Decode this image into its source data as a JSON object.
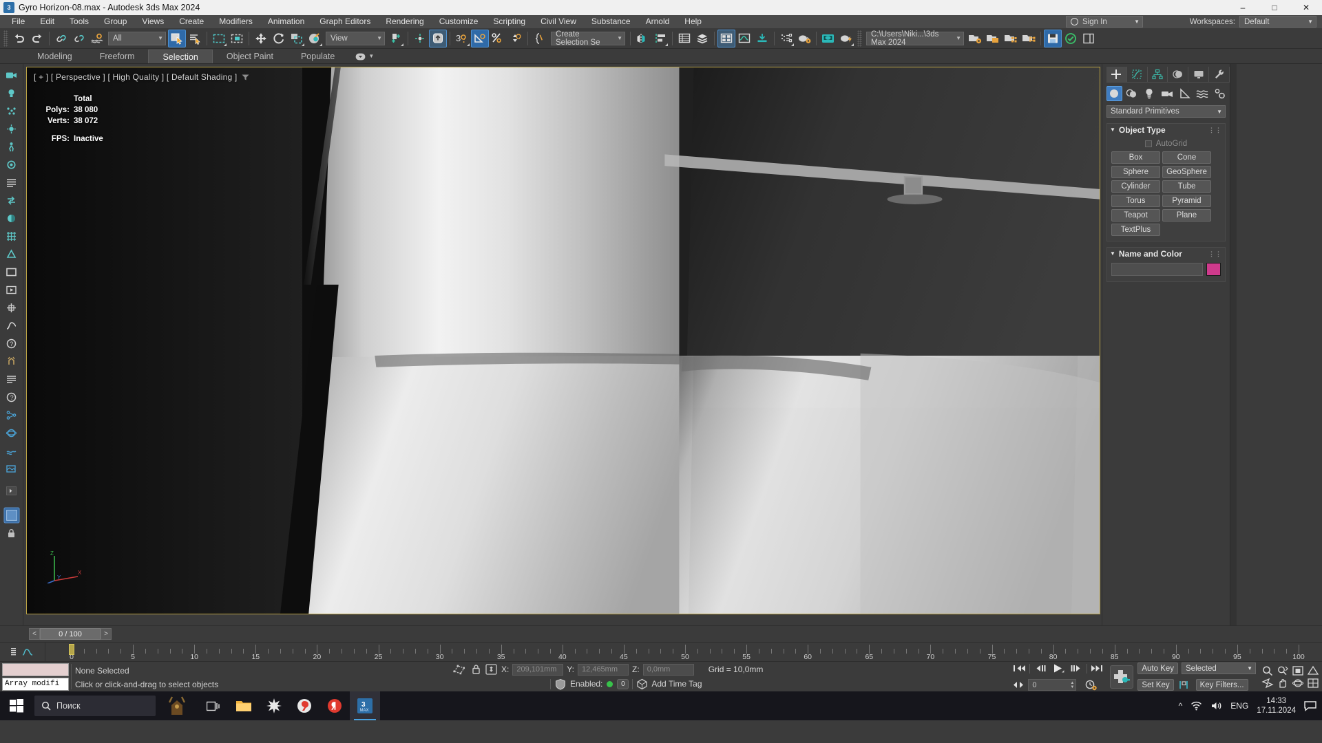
{
  "window": {
    "title": "Gyro Horizon-08.max - Autodesk 3ds Max 2024",
    "app_icon": "3ds-max-icon",
    "minimize": "–",
    "maximize": "□",
    "close": "✕"
  },
  "menu": {
    "items": [
      {
        "label": "File",
        "accel": "F"
      },
      {
        "label": "Edit",
        "accel": "E"
      },
      {
        "label": "Tools",
        "accel": "T"
      },
      {
        "label": "Group",
        "accel": "G"
      },
      {
        "label": "Views",
        "accel": "V"
      },
      {
        "label": "Create",
        "accel": "C"
      },
      {
        "label": "Modifiers",
        "accel": "M"
      },
      {
        "label": "Animation",
        "accel": "A"
      },
      {
        "label": "Graph Editors",
        "accel": "G"
      },
      {
        "label": "Rendering",
        "accel": "R"
      },
      {
        "label": "Customize",
        "accel": "u"
      },
      {
        "label": "Scripting",
        "accel": "S"
      },
      {
        "label": "Civil View",
        "accel": "V"
      },
      {
        "label": "Substance",
        "accel": ""
      },
      {
        "label": "Arnold",
        "accel": ""
      },
      {
        "label": "Help",
        "accel": "H"
      }
    ],
    "sign_in": "Sign In",
    "workspaces_label": "Workspaces:",
    "workspaces_value": "Default"
  },
  "toolbar": {
    "selection_filter": "All",
    "coord_system": "View",
    "named_selection_set": "Create Selection Se",
    "project_path": "C:\\Users\\Niki...\\3ds Max 2024"
  },
  "ribbon": {
    "tabs": [
      "Modeling",
      "Freeform",
      "Selection",
      "Object Paint",
      "Populate"
    ],
    "active_tab": "Selection"
  },
  "viewport": {
    "label": "[ + ] [ Perspective ] [ High Quality ] [ Default Shading ]",
    "stats": {
      "col_header": "Total",
      "polys_label": "Polys:",
      "polys_value": "38 080",
      "verts_label": "Verts:",
      "verts_value": "38 072",
      "fps_label": "FPS:",
      "fps_value": "Inactive"
    },
    "axis": {
      "x": "X",
      "y": "Y",
      "z": "Z"
    }
  },
  "command_panel": {
    "tabs": [
      "create-tab",
      "modify-tab",
      "hierarchy-tab",
      "motion-tab",
      "display-tab",
      "utilities-tab"
    ],
    "active_tab_index": 0,
    "categories": [
      "geometry-category",
      "shapes-category",
      "lights-category",
      "cameras-category",
      "helpers-category",
      "space-warps-category",
      "systems-category"
    ],
    "active_category_index": 0,
    "primitive_dropdown": "Standard Primitives",
    "object_type": {
      "title": "Object Type",
      "autogrid_label": "AutoGrid",
      "autogrid_checked": false,
      "buttons": [
        "Box",
        "Cone",
        "Sphere",
        "GeoSphere",
        "Cylinder",
        "Tube",
        "Torus",
        "Pyramid",
        "Teapot",
        "Plane",
        "TextPlus"
      ]
    },
    "name_and_color": {
      "title": "Name and Color",
      "name_value": "",
      "color": "#cf3a8c"
    }
  },
  "time_slider": {
    "prev_label": "<",
    "next_label": ">",
    "current": "0 / 100",
    "ruler_labels": [
      "0",
      "5",
      "10",
      "15",
      "20",
      "25",
      "30",
      "35",
      "40",
      "45",
      "50",
      "55",
      "60",
      "65",
      "70",
      "75",
      "80",
      "85",
      "90",
      "95",
      "100"
    ],
    "ruler_min": 0,
    "ruler_max": 100,
    "playhead_frame": 0
  },
  "status_bar": {
    "mxs_listener_text": "Array modifi",
    "selection_status": "None Selected",
    "prompt": "Click or click-and-drag to select objects",
    "coords": {
      "x_label": "X:",
      "x_value": "209,101mm",
      "y_label": "Y:",
      "y_value": "12,465mm",
      "z_label": "Z:",
      "z_value": "0,0mm",
      "grid": "Grid = 10,0mm"
    },
    "enabled_label": "Enabled:",
    "enabled_count": "0",
    "add_time_tag": "Add Time Tag",
    "animation": {
      "frame_value": "0",
      "auto_key": "Auto Key",
      "set_key": "Set Key",
      "key_mode": "Selected",
      "key_filters": "Key Filters..."
    }
  },
  "taskbar": {
    "search_placeholder": "Поиск",
    "apps": [
      "task-view-icon",
      "file-explorer-icon",
      "photo-app-icon",
      "yandex-browser-icon",
      "yandex-icon",
      "3ds-max-icon"
    ],
    "active_app_index": 5,
    "language": "ENG",
    "time": "14:33",
    "date": "17.11.2024"
  }
}
